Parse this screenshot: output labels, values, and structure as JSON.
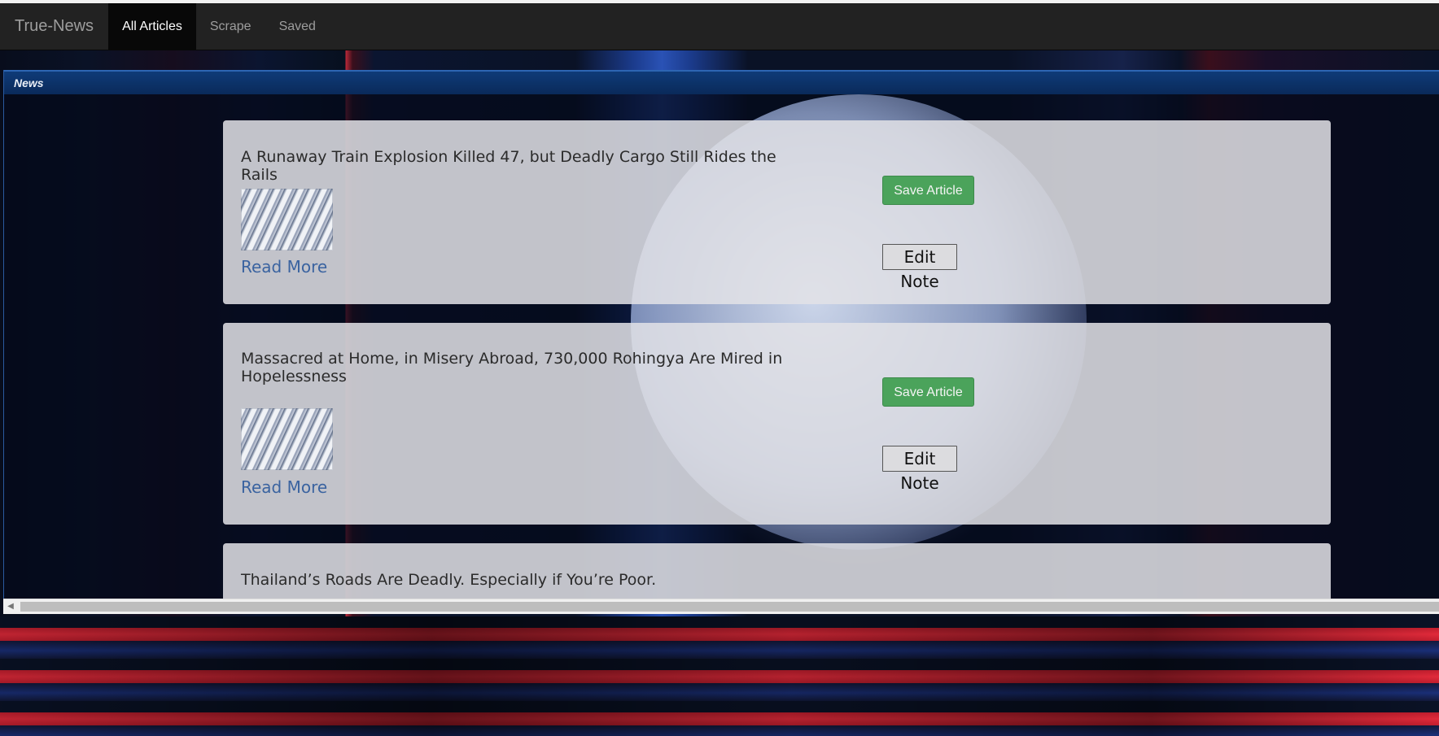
{
  "navbar": {
    "brand": "True-News",
    "items": [
      {
        "label": "All Articles",
        "active": true
      },
      {
        "label": "Scrape",
        "active": false
      },
      {
        "label": "Saved",
        "active": false
      }
    ]
  },
  "panel": {
    "header": "News"
  },
  "articles": [
    {
      "title": "A Runaway Train Explosion Killed 47, but Deadly Cargo Still Rides the Rails",
      "read_more": "Read More",
      "save_label": "Save Article",
      "note_label": "Edit Note"
    },
    {
      "title": "Massacred at Home, in Misery Abroad, 730,000 Rohingya Are Mired in Hopelessness",
      "read_more": "Read More",
      "save_label": "Save Article",
      "note_label": "Edit Note"
    },
    {
      "title": "Thailand’s Roads Are Deadly. Especially if You’re Poor."
    }
  ],
  "scrollbar": {
    "left_arrow": "◀"
  },
  "colors": {
    "navbar_bg": "#222222",
    "nav_active_bg": "#080808",
    "save_button": "#4ba35b",
    "read_more_link": "#3a63a0",
    "panel_header": "#0f3b78"
  }
}
